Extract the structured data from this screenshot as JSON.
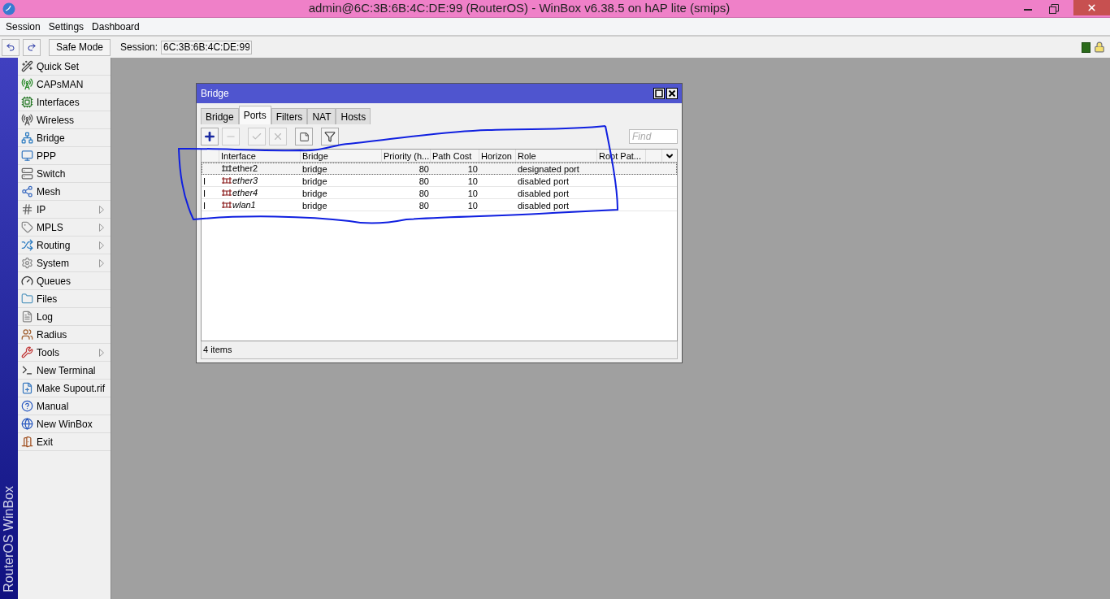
{
  "window": {
    "title": "admin@6C:3B:6B:4C:DE:99 (RouterOS) - WinBox v6.38.5 on hAP lite (smips)"
  },
  "menu": [
    "Session",
    "Settings",
    "Dashboard"
  ],
  "toolbar": {
    "safe_mode": "Safe Mode",
    "session_label": "Session:",
    "session_value": "6C:3B:6B:4C:DE:99"
  },
  "side_label": "RouterOS WinBox",
  "sidebar": {
    "items": [
      {
        "label": "Quick Set",
        "submenu": false
      },
      {
        "label": "CAPsMAN",
        "submenu": false
      },
      {
        "label": "Interfaces",
        "submenu": false
      },
      {
        "label": "Wireless",
        "submenu": false
      },
      {
        "label": "Bridge",
        "submenu": false
      },
      {
        "label": "PPP",
        "submenu": false
      },
      {
        "label": "Switch",
        "submenu": false
      },
      {
        "label": "Mesh",
        "submenu": false
      },
      {
        "label": "IP",
        "submenu": true
      },
      {
        "label": "MPLS",
        "submenu": true
      },
      {
        "label": "Routing",
        "submenu": true
      },
      {
        "label": "System",
        "submenu": true
      },
      {
        "label": "Queues",
        "submenu": false
      },
      {
        "label": "Files",
        "submenu": false
      },
      {
        "label": "Log",
        "submenu": false
      },
      {
        "label": "Radius",
        "submenu": false
      },
      {
        "label": "Tools",
        "submenu": true
      },
      {
        "label": "New Terminal",
        "submenu": false
      },
      {
        "label": "Make Supout.rif",
        "submenu": false
      },
      {
        "label": "Manual",
        "submenu": false
      },
      {
        "label": "New WinBox",
        "submenu": false
      },
      {
        "label": "Exit",
        "submenu": false
      }
    ]
  },
  "bridge_window": {
    "title": "Bridge",
    "tabs": [
      {
        "label": "Bridge",
        "selected": false
      },
      {
        "label": "Ports",
        "selected": true
      },
      {
        "label": "Filters",
        "selected": false
      },
      {
        "label": "NAT",
        "selected": false
      },
      {
        "label": "Hosts",
        "selected": false
      }
    ],
    "find": {
      "placeholder": "Find"
    },
    "table": {
      "columns": [
        "Interface",
        "Bridge",
        "Priority (h...",
        "Path Cost",
        "Horizon",
        "Role",
        "Root Pat..."
      ],
      "rows": [
        {
          "flag": "",
          "disabled": false,
          "selected": true,
          "interface": "ether2",
          "bridge": "bridge",
          "priority": "80",
          "path_cost": "10",
          "role": "designated port"
        },
        {
          "flag": "I",
          "disabled": true,
          "selected": false,
          "interface": "ether3",
          "bridge": "bridge",
          "priority": "80",
          "path_cost": "10",
          "role": "disabled port"
        },
        {
          "flag": "I",
          "disabled": true,
          "selected": false,
          "interface": "ether4",
          "bridge": "bridge",
          "priority": "80",
          "path_cost": "10",
          "role": "disabled port"
        },
        {
          "flag": "I",
          "disabled": true,
          "selected": false,
          "interface": "wlan1",
          "bridge": "bridge",
          "priority": "80",
          "path_cost": "10",
          "role": "disabled port"
        }
      ]
    },
    "status": "4 items"
  }
}
